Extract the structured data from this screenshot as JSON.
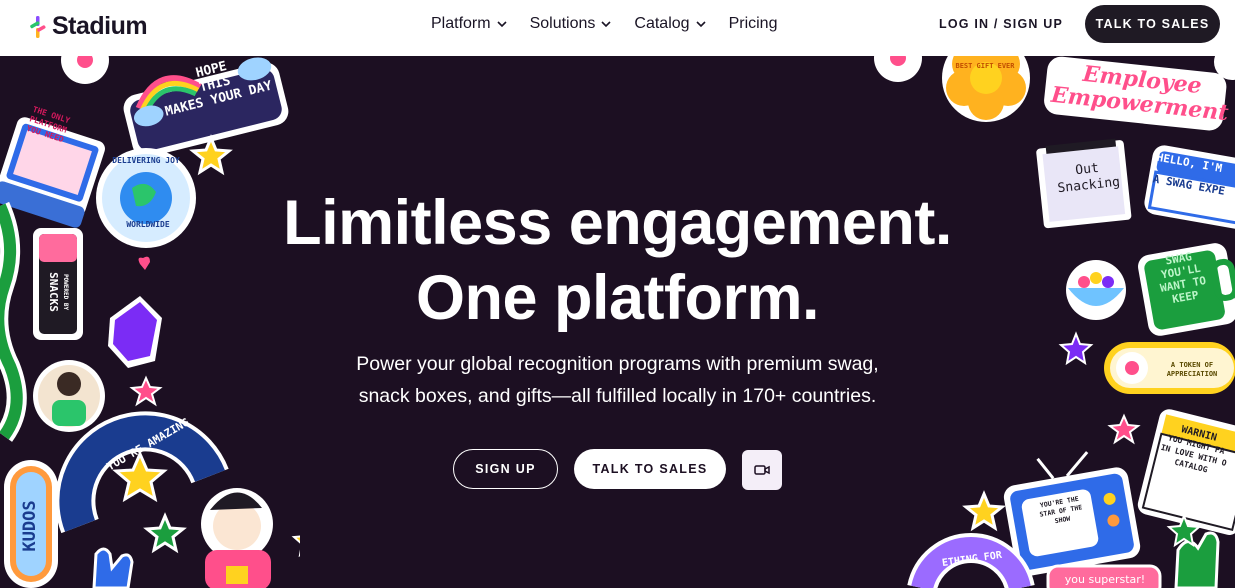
{
  "nav": {
    "brand": "Stadium",
    "menu": [
      {
        "label": "Platform",
        "has_dropdown": true
      },
      {
        "label": "Solutions",
        "has_dropdown": true
      },
      {
        "label": "Catalog",
        "has_dropdown": true
      },
      {
        "label": "Pricing",
        "has_dropdown": false
      }
    ],
    "login_label": "LOG IN / SIGN UP",
    "talk_label": "TALK TO SALES"
  },
  "hero": {
    "headline_line1": "Limitless engagement.",
    "headline_line2": "One platform.",
    "sub_line1": "Power your global recognition programs with premium swag,",
    "sub_line2": "snack boxes, and gifts—all fulfilled locally in 170+ countries.",
    "signup_label": "SIGN UP",
    "talk_label": "TALK TO SALES",
    "video_icon": "video-camera-icon"
  },
  "stickers": {
    "hope_1": "HOPE",
    "hope_2": "THIS",
    "hope_3": "MAKES YOUR DAY",
    "platform_1": "THE ONLY",
    "platform_2": "PLATFORM",
    "platform_3": "YOU NEED",
    "joy_1": "DELIVERING JOY",
    "joy_2": "WORLDWIDE",
    "powered_1": "POWERED BY",
    "powered_2": "SNACKS",
    "amazing": "YOU'RE AMAZING",
    "kudos": "KUDOS",
    "best_gift": "BEST GIFT EVER",
    "employee_1": "Employee",
    "employee_2": "Empowerment",
    "snacking_1": "Out",
    "snacking_2": "Snacking",
    "hello_1": "HELLO, I'M",
    "hello_2": "A SWAG EXPE",
    "swag_1": "SWAG",
    "swag_2": "YOU'LL",
    "swag_3": "WANT TO",
    "swag_4": "KEEP",
    "token_1": "A TOKEN OF",
    "token_2": "APPRECIATION",
    "warning_1": "WARNIN",
    "warning_2": "YOU MIGHT FA",
    "warning_3": "IN LOVE WITH O",
    "warning_4": "CATALOG",
    "tv_1": "YOU'RE THE",
    "tv_2": "STAR OF THE",
    "tv_3": "SHOW",
    "something": "ETHING FOR",
    "superstar": "you superstar!"
  },
  "colors": {
    "hero_bg": "#1c0f22",
    "dark_button": "#1f1a24",
    "accent_pink": "#ff4f8b",
    "accent_yellow": "#ffd21f",
    "accent_purple": "#7b2cf5",
    "accent_green": "#1b9e3e",
    "accent_blue": "#2f6be8"
  }
}
